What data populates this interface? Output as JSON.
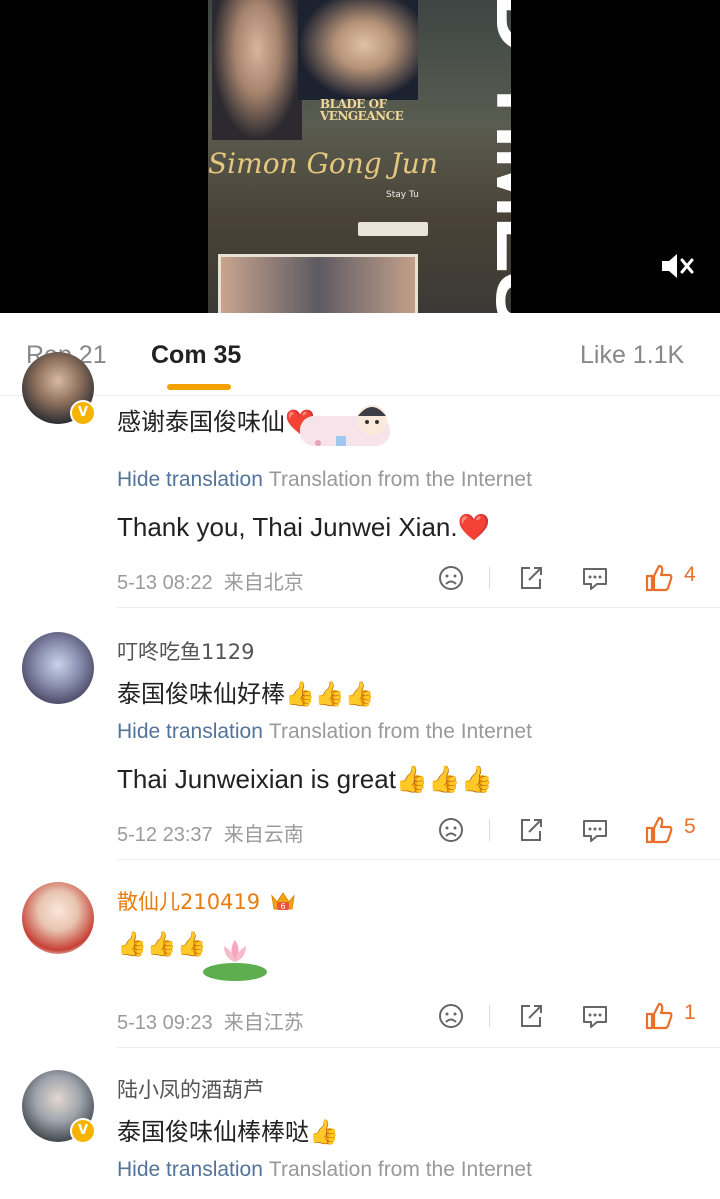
{
  "video": {
    "poster_title": "BLADE OF VENGEANCE",
    "poster_script": "Simon Gong Jun",
    "poster_vertical_text": "D TIMES",
    "poster_subtext": "Stay Tu",
    "mute_icon": "speaker-muted-icon"
  },
  "tabs": [
    {
      "label": "Rep 21"
    },
    {
      "label": "Com 35"
    },
    {
      "label": "Like 1.1K"
    }
  ],
  "comments": [
    {
      "text": "感谢泰国俊味仙❤️",
      "hide_translation": "Hide translation",
      "translation_from": "Translation from the Internet",
      "translation": "Thank you, Thai Junwei Xian.❤️",
      "date": "5-13 08:22",
      "location": "来自北京",
      "likes": "4"
    },
    {
      "username": "叮咚吃鱼1129",
      "text": "泰国俊味仙好棒👍👍👍",
      "hide_translation": "Hide translation",
      "translation_from": "Translation from the Internet",
      "translation": "Thai Junweixian is great👍👍👍",
      "date": "5-12 23:37",
      "location": "来自云南",
      "likes": "5"
    },
    {
      "username": "散仙儿210419",
      "text": "👍👍👍",
      "date": "5-13 09:23",
      "location": "来自江苏",
      "likes": "1"
    },
    {
      "username": "陆小凤的酒葫芦",
      "text": "泰国俊味仙棒棒哒👍",
      "hide_translation": "Hide translation",
      "translation_from": "Translation from the Internet"
    }
  ],
  "colors": {
    "accent": "#f5a200",
    "like": "#e8702a",
    "link": "#53739a",
    "vip_name": "#ea7d10"
  }
}
